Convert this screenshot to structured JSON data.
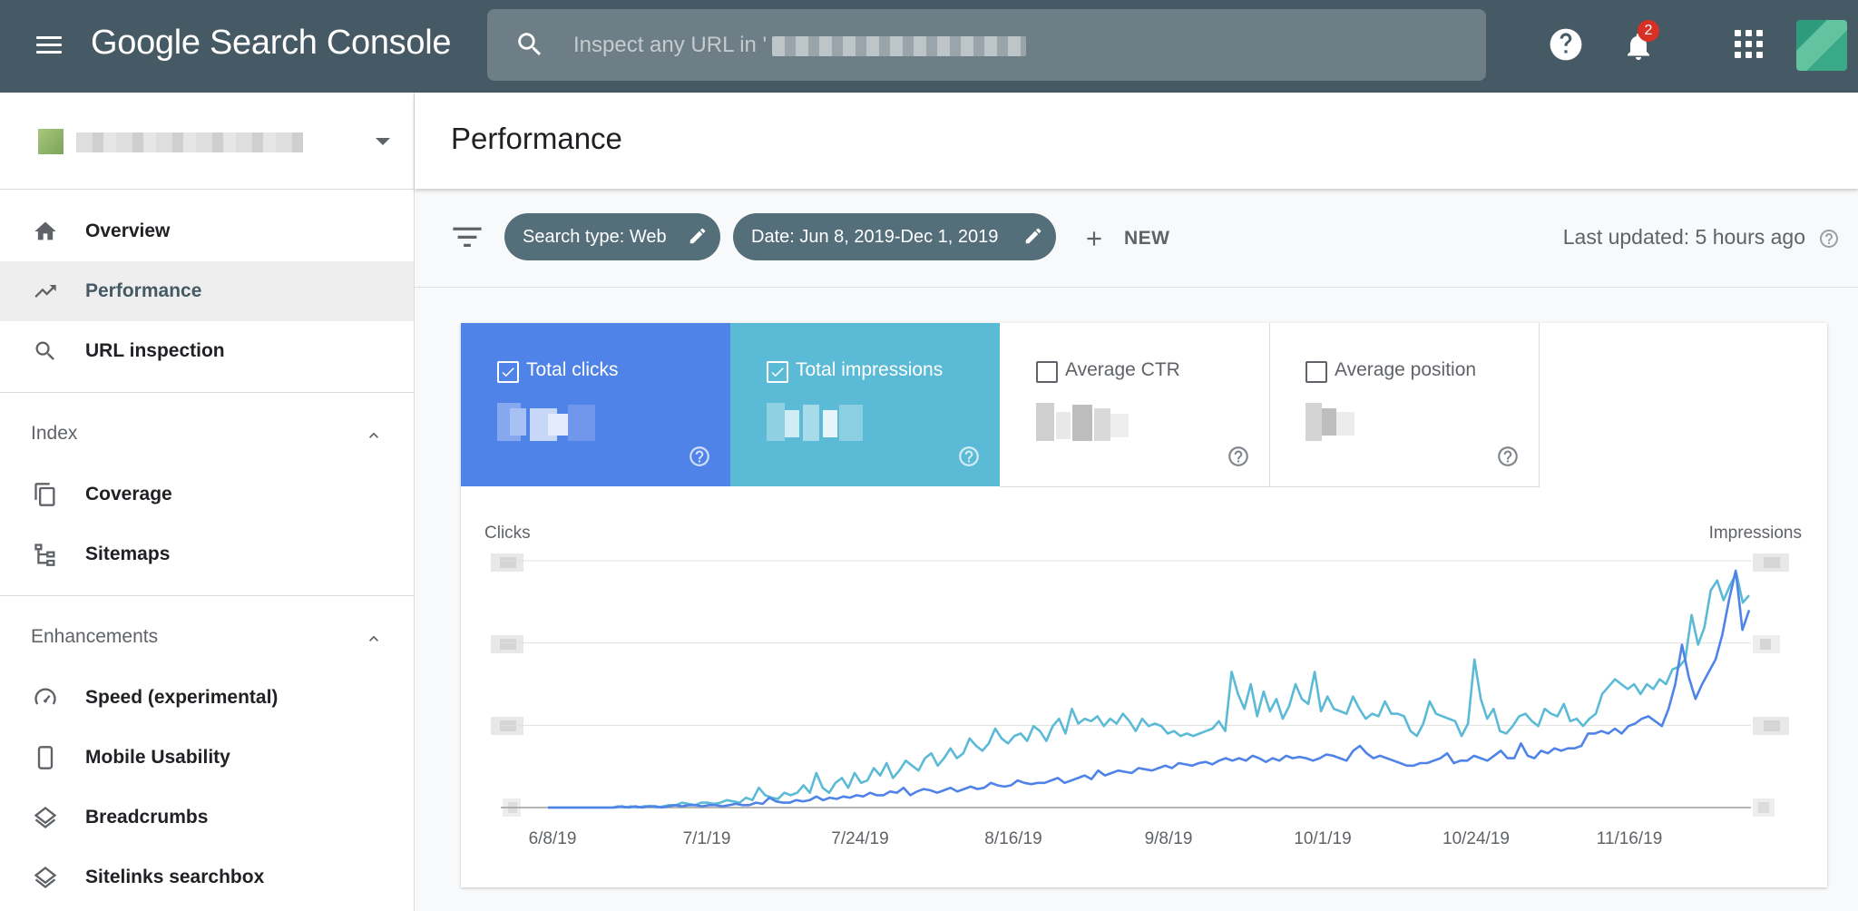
{
  "app": {
    "title_google": "Google",
    "title_rest": "Search Console",
    "search_placeholder": "Inspect any URL in '",
    "notification_count": "2"
  },
  "sidebar": {
    "property_name": "",
    "items": [
      {
        "label": "Overview",
        "icon": "home-icon"
      },
      {
        "label": "Performance",
        "icon": "trending-up-icon",
        "active": true
      },
      {
        "label": "URL inspection",
        "icon": "search-icon"
      }
    ],
    "index": {
      "label": "Index",
      "items": [
        {
          "label": "Coverage",
          "icon": "copy-icon"
        },
        {
          "label": "Sitemaps",
          "icon": "sitemap-icon"
        }
      ]
    },
    "enhancements": {
      "label": "Enhancements",
      "items": [
        {
          "label": "Speed (experimental)",
          "icon": "speedometer-icon"
        },
        {
          "label": "Mobile Usability",
          "icon": "phone-icon"
        },
        {
          "label": "Breadcrumbs",
          "icon": "layers-icon"
        },
        {
          "label": "Sitelinks searchbox",
          "icon": "layers-icon"
        }
      ]
    }
  },
  "main": {
    "title": "Performance",
    "filters": {
      "search_type": "Search type: Web",
      "date": "Date: Jun 8, 2019-Dec 1, 2019",
      "new_label": "NEW",
      "last_updated": "Last updated: 5 hours ago"
    },
    "metrics": [
      {
        "label": "Total clicks",
        "checked": true,
        "color": "#4f83e8"
      },
      {
        "label": "Total impressions",
        "checked": true,
        "color": "#5bbad5"
      },
      {
        "label": "Average CTR",
        "checked": false
      },
      {
        "label": "Average position",
        "checked": false
      }
    ]
  },
  "chart_data": {
    "type": "line",
    "left_axis_label": "Clicks",
    "right_axis_label": "Impressions",
    "x_ticks": [
      "6/8/19",
      "7/1/19",
      "7/24/19",
      "8/16/19",
      "9/8/19",
      "10/1/19",
      "10/24/19",
      "11/16/19"
    ],
    "x_range": [
      "2019-06-08",
      "2019-12-01"
    ],
    "y_relative_range": [
      0,
      1
    ],
    "note": "values are relative (axis tick values are blurred in the source)",
    "series": [
      {
        "name": "Total clicks",
        "color": "#4f83e8",
        "values": [
          0.0,
          0.0,
          0.0,
          0.0,
          0.0,
          0.0,
          0.0,
          0.0,
          0.0,
          0.0,
          0.0,
          0.005,
          0.0,
          0.005,
          0.0,
          0.005,
          0.005,
          0.0,
          0.005,
          0.01,
          0.005,
          0.01,
          0.01,
          0.005,
          0.01,
          0.01,
          0.005,
          0.01,
          0.015,
          0.01,
          0.01,
          0.02,
          0.015,
          0.04,
          0.025,
          0.02,
          0.02,
          0.03,
          0.025,
          0.03,
          0.045,
          0.03,
          0.04,
          0.035,
          0.045,
          0.04,
          0.05,
          0.045,
          0.06,
          0.05,
          0.05,
          0.065,
          0.06,
          0.08,
          0.05,
          0.065,
          0.075,
          0.07,
          0.06,
          0.07,
          0.08,
          0.065,
          0.075,
          0.085,
          0.075,
          0.08,
          0.1,
          0.09,
          0.085,
          0.09,
          0.11,
          0.1,
          0.095,
          0.1,
          0.1,
          0.11,
          0.12,
          0.1,
          0.11,
          0.12,
          0.13,
          0.115,
          0.15,
          0.13,
          0.14,
          0.15,
          0.145,
          0.14,
          0.16,
          0.155,
          0.15,
          0.16,
          0.17,
          0.16,
          0.18,
          0.175,
          0.17,
          0.18,
          0.185,
          0.175,
          0.19,
          0.2,
          0.19,
          0.2,
          0.19,
          0.21,
          0.2,
          0.185,
          0.2,
          0.19,
          0.21,
          0.2,
          0.205,
          0.2,
          0.19,
          0.2,
          0.215,
          0.21,
          0.2,
          0.19,
          0.23,
          0.25,
          0.22,
          0.2,
          0.21,
          0.2,
          0.19,
          0.18,
          0.17,
          0.17,
          0.18,
          0.18,
          0.19,
          0.2,
          0.22,
          0.18,
          0.19,
          0.19,
          0.21,
          0.2,
          0.19,
          0.21,
          0.23,
          0.2,
          0.2,
          0.26,
          0.21,
          0.2,
          0.23,
          0.22,
          0.24,
          0.23,
          0.24,
          0.24,
          0.25,
          0.3,
          0.3,
          0.31,
          0.3,
          0.32,
          0.3,
          0.33,
          0.34,
          0.36,
          0.37,
          0.35,
          0.33,
          0.4,
          0.5,
          0.66,
          0.53,
          0.44,
          0.5,
          0.55,
          0.6,
          0.7,
          0.84,
          0.96,
          0.72,
          0.8
        ]
      },
      {
        "name": "Total impressions",
        "color": "#5bbad5",
        "values": [
          0.0,
          0.0,
          0.0,
          0.0,
          0.0,
          0.0,
          0.0,
          0.0,
          0.0,
          0.0,
          0.0,
          0.005,
          0.0,
          0.005,
          0.0,
          0.005,
          0.005,
          0.0,
          0.005,
          0.01,
          0.01,
          0.02,
          0.015,
          0.01,
          0.02,
          0.02,
          0.015,
          0.02,
          0.03,
          0.025,
          0.02,
          0.04,
          0.03,
          0.08,
          0.05,
          0.04,
          0.035,
          0.06,
          0.05,
          0.06,
          0.09,
          0.06,
          0.14,
          0.08,
          0.06,
          0.1,
          0.12,
          0.08,
          0.14,
          0.1,
          0.11,
          0.16,
          0.13,
          0.18,
          0.12,
          0.15,
          0.19,
          0.17,
          0.15,
          0.2,
          0.22,
          0.17,
          0.2,
          0.24,
          0.2,
          0.22,
          0.28,
          0.25,
          0.23,
          0.26,
          0.32,
          0.28,
          0.26,
          0.29,
          0.3,
          0.27,
          0.33,
          0.31,
          0.27,
          0.33,
          0.36,
          0.3,
          0.4,
          0.34,
          0.36,
          0.35,
          0.37,
          0.33,
          0.36,
          0.34,
          0.38,
          0.35,
          0.31,
          0.36,
          0.33,
          0.34,
          0.33,
          0.3,
          0.31,
          0.29,
          0.3,
          0.29,
          0.3,
          0.31,
          0.32,
          0.35,
          0.31,
          0.55,
          0.46,
          0.4,
          0.5,
          0.37,
          0.47,
          0.39,
          0.44,
          0.36,
          0.41,
          0.5,
          0.44,
          0.42,
          0.55,
          0.39,
          0.45,
          0.4,
          0.39,
          0.38,
          0.45,
          0.4,
          0.36,
          0.38,
          0.37,
          0.43,
          0.38,
          0.38,
          0.37,
          0.31,
          0.29,
          0.34,
          0.43,
          0.38,
          0.37,
          0.36,
          0.35,
          0.29,
          0.34,
          0.6,
          0.44,
          0.36,
          0.4,
          0.31,
          0.3,
          0.33,
          0.37,
          0.38,
          0.35,
          0.33,
          0.4,
          0.38,
          0.37,
          0.42,
          0.35,
          0.36,
          0.33,
          0.36,
          0.38,
          0.46,
          0.49,
          0.52,
          0.5,
          0.48,
          0.5,
          0.46,
          0.5,
          0.48,
          0.52,
          0.5,
          0.56,
          0.57,
          0.6,
          0.78,
          0.66,
          0.73,
          0.88,
          0.92,
          0.84,
          0.9,
          0.95,
          0.83,
          0.86
        ]
      }
    ]
  }
}
